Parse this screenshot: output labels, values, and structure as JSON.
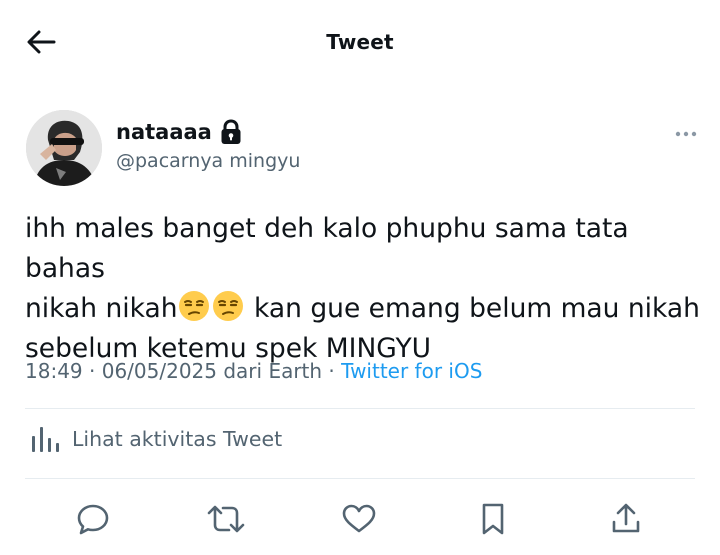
{
  "header": {
    "title": "Tweet",
    "back_icon": "arrow-left-icon"
  },
  "author": {
    "display_name": "nataaaa",
    "handle": "@pacarnya mingyu",
    "protected_icon": "lock-icon"
  },
  "tweet": {
    "text_line1": "ihh males banget deh kalo phuphu sama tata bahas",
    "text_line2_before": "nikah nikah",
    "emoji": "unamused-face-emoji",
    "text_line2_after": " kan gue emang belum mau nikah",
    "text_line3": "sebelum ketemu spek MINGYU"
  },
  "meta": {
    "time": "18:49",
    "separator": " · ",
    "date": "06/05/2025",
    "location": " dari Earth",
    "source": "Twitter for iOS"
  },
  "activity": {
    "label": "Lihat aktivitas Tweet",
    "icon": "analytics-bars-icon"
  },
  "actions": [
    "reply-icon",
    "retweet-icon",
    "like-icon",
    "bookmark-icon",
    "share-icon"
  ],
  "colors": {
    "text": "#0f1419",
    "secondary": "#536471",
    "link": "#1d9bf0",
    "divider": "#e6ecf0"
  }
}
